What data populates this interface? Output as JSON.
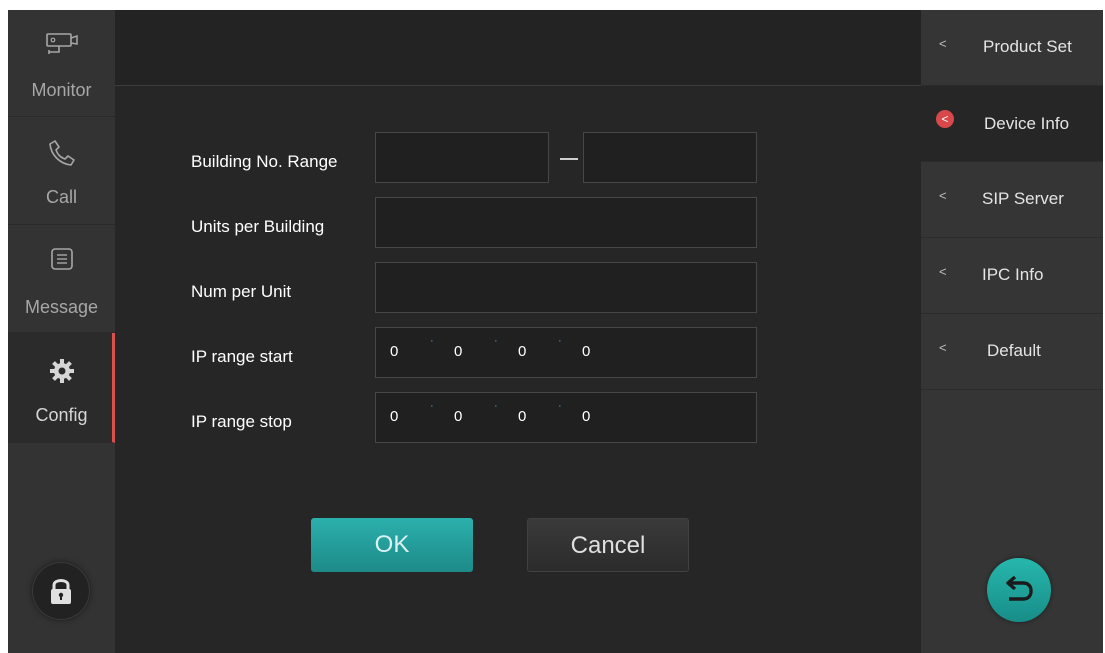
{
  "sidebar": {
    "items": [
      {
        "label": "Monitor",
        "icon": "camera-icon"
      },
      {
        "label": "Call",
        "icon": "phone-icon"
      },
      {
        "label": "Message",
        "icon": "message-icon"
      },
      {
        "label": "Config",
        "icon": "gear-icon"
      }
    ],
    "active": "Config",
    "lock_icon": "lock-icon",
    "accent_color": "#d9514c"
  },
  "form": {
    "building_range_label": "Building No. Range",
    "building_range_separator": "–",
    "building_from": "",
    "building_to": "",
    "units_label": "Units per Building",
    "units_value": "",
    "num_label": "Num per Unit",
    "num_value": "",
    "ip_start_label": "IP range start",
    "ip_start": [
      "0",
      "0",
      "0",
      "0"
    ],
    "ip_stop_label": "IP range stop",
    "ip_stop": [
      "0",
      "0",
      "0",
      "0"
    ],
    "ip_separator": "·",
    "ok_label": "OK",
    "cancel_label": "Cancel"
  },
  "right_panel": {
    "items": [
      {
        "label": "Product Set"
      },
      {
        "label": "Device Info"
      },
      {
        "label": "SIP Server"
      },
      {
        "label": "IPC Info"
      },
      {
        "label": "Default"
      }
    ],
    "active": "Device Info",
    "chevron": "<",
    "back_icon": "back-arrow-icon",
    "accent_color": "#26b3aa"
  }
}
